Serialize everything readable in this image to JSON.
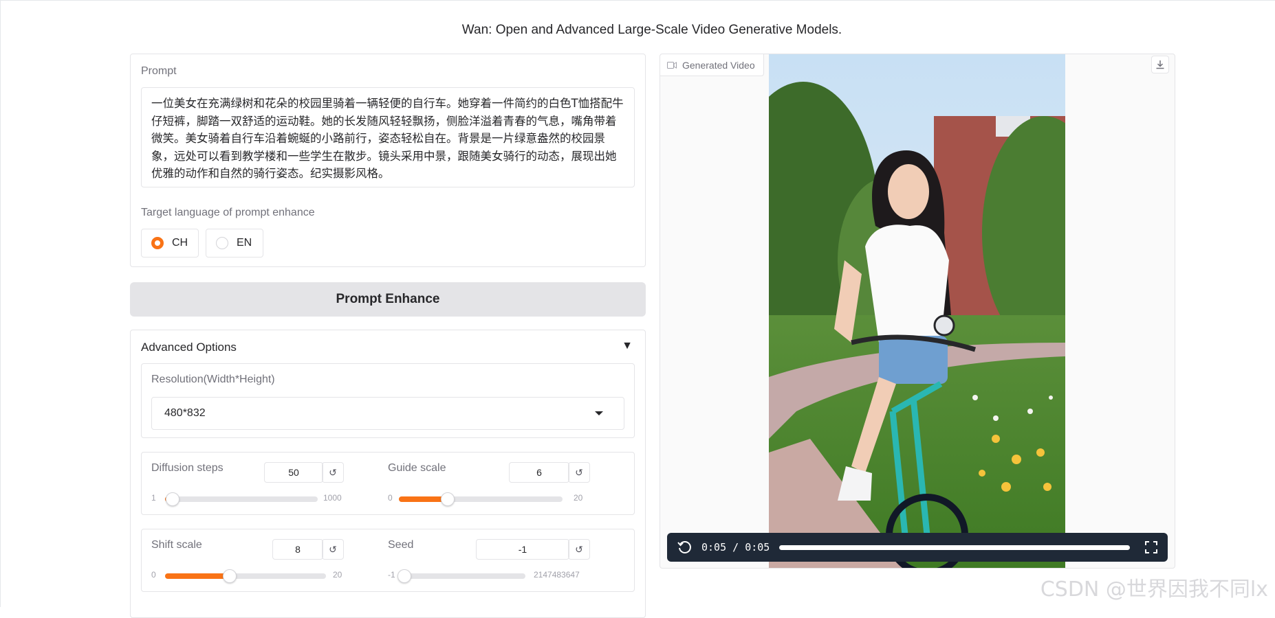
{
  "app": {
    "title": "Wan: Open and Advanced Large-Scale Video Generative Models."
  },
  "prompt": {
    "label": "Prompt",
    "value": "一位美女在充满绿树和花朵的校园里骑着一辆轻便的自行车。她穿着一件简约的白色T恤搭配牛仔短裤，脚踏一双舒适的运动鞋。她的长发随风轻轻飘扬，侧脸洋溢着青春的气息，嘴角带着微笑。美女骑着自行车沿着蜿蜒的小路前行，姿态轻松自在。背景是一片绿意盎然的校园景象，远处可以看到教学楼和一些学生在散步。镜头采用中景，跟随美女骑行的动态，展现出她优雅的动作和自然的骑行姿态。纪实摄影风格。"
  },
  "language": {
    "label": "Target language of prompt enhance",
    "options": [
      "CH",
      "EN"
    ],
    "selected": "CH"
  },
  "enhance_button": "Prompt Enhance",
  "advanced": {
    "title": "Advanced Options",
    "expand_icon": "triangle-down-icon",
    "resolution": {
      "label": "Resolution(Width*Height)",
      "value": "480*832"
    },
    "sliders": {
      "diffusion_steps": {
        "label": "Diffusion steps",
        "value": "50",
        "min": "1",
        "max": "1000",
        "fraction": 0.049
      },
      "guide_scale": {
        "label": "Guide scale",
        "value": "6",
        "min": "0",
        "max": "20",
        "fraction": 0.3
      },
      "shift_scale": {
        "label": "Shift scale",
        "value": "8",
        "min": "0",
        "max": "20",
        "fraction": 0.4
      },
      "seed": {
        "label": "Seed",
        "value": "-1",
        "min": "-1",
        "max": "2147483647",
        "fraction": 0.0
      }
    }
  },
  "video": {
    "label": "Generated Video",
    "time": "0:05 / 0:05",
    "progress": 1.0
  },
  "colors": {
    "accent": "#f97316",
    "controls_bg": "#1f2937"
  },
  "watermark": "CSDN @世界因我不同lx"
}
